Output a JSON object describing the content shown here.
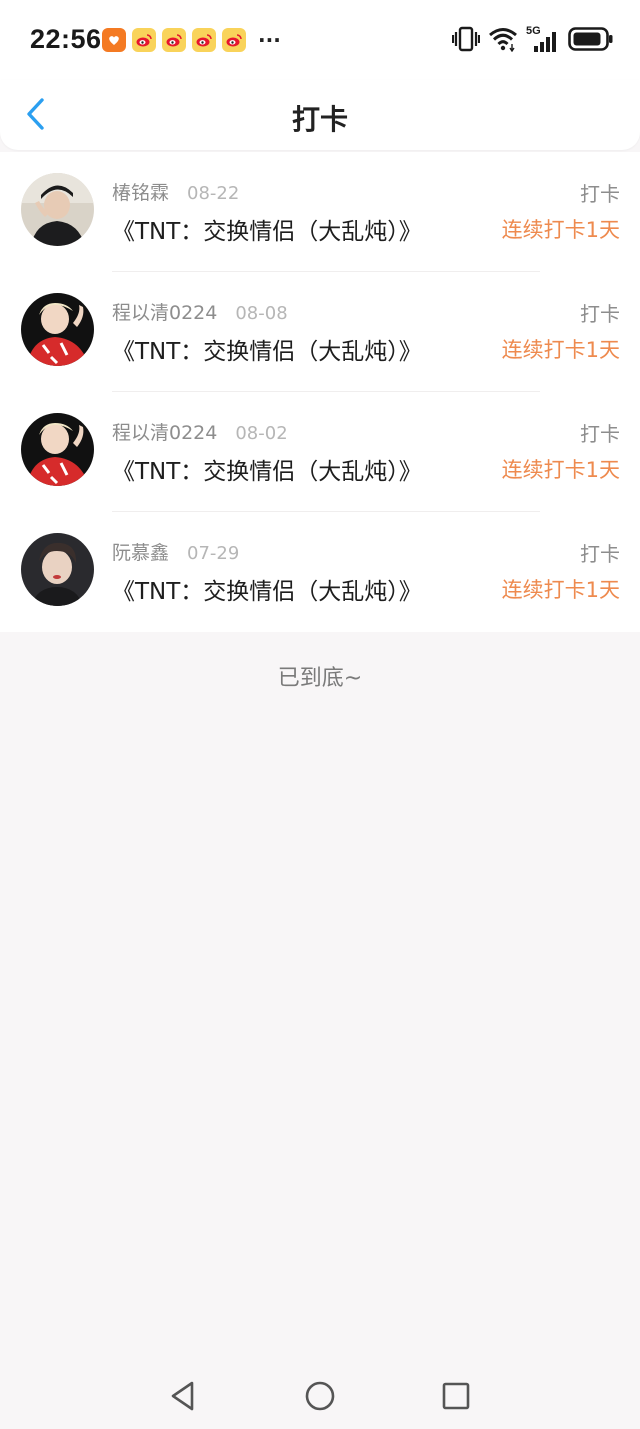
{
  "status_bar": {
    "time": "22:56",
    "notification_icons": [
      "taobao-icon",
      "weibo-icon",
      "weibo-icon",
      "weibo-icon",
      "weibo-icon"
    ],
    "more": "···",
    "network": "5G",
    "system_icons": [
      "vibrate-icon",
      "wifi-icon",
      "signal-icon",
      "battery-icon"
    ]
  },
  "header": {
    "title": "打卡",
    "back_icon": "chevron-left-icon"
  },
  "records": [
    {
      "name": "椿铭霖",
      "date": "08-22",
      "book": "《TNT：交换情侣（大乱炖）》",
      "action": "打卡",
      "streak": "连续打卡1天"
    },
    {
      "name": "程以清0224",
      "date": "08-08",
      "book": "《TNT：交换情侣（大乱炖）》",
      "action": "打卡",
      "streak": "连续打卡1天"
    },
    {
      "name": "程以清0224",
      "date": "08-02",
      "book": "《TNT：交换情侣（大乱炖）》",
      "action": "打卡",
      "streak": "连续打卡1天"
    },
    {
      "name": "阮慕鑫",
      "date": "07-29",
      "book": "《TNT：交换情侣（大乱炖）》",
      "action": "打卡",
      "streak": "连续打卡1天"
    }
  ],
  "footer_text": "已到底~",
  "nav": [
    "back-triangle-icon",
    "home-circle-icon",
    "recents-square-icon"
  ],
  "colors": {
    "accent": "#2b9ff0",
    "streak": "#ee8a4e",
    "background": "#f8f6f7"
  }
}
